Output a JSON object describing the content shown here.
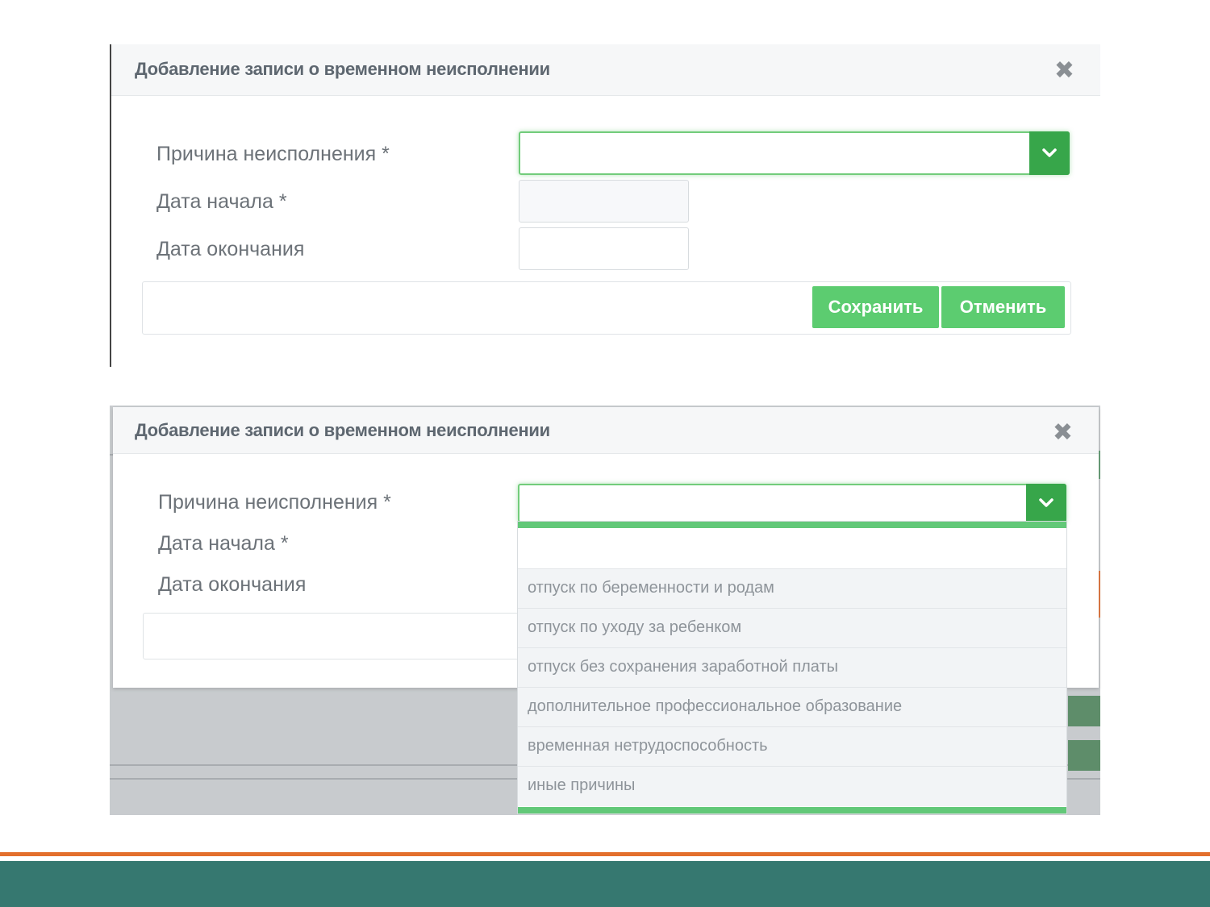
{
  "dialog_top": {
    "title": "Добавление записи о временном неисполнении",
    "close_glyph": "✖",
    "fields": {
      "reason_label": "Причина неисполнения  *",
      "reason_value": "",
      "start_label": "Дата начала  *",
      "start_value": "",
      "end_label": "Дата окончания",
      "end_value": ""
    },
    "buttons": {
      "save": "Сохранить",
      "cancel": "Отменить"
    }
  },
  "dialog_bottom": {
    "title": "Добавление записи о временном неисполнении",
    "close_glyph": "✖",
    "fields": {
      "reason_label": "Причина неисполнения  *",
      "start_label": "Дата начала  *",
      "end_label": "Дата окончания"
    },
    "dropdown": {
      "search_value": "",
      "options": [
        "отпуск по беременности и родам",
        "отпуск по уходу за ребенком",
        "отпуск без сохранения заработной платы",
        "дополнительное профессиональное образование",
        "временная нетрудоспособность",
        "иные причины"
      ]
    }
  },
  "icons": {
    "close": "close-icon",
    "dropdown": "chevron-down-icon"
  },
  "colors": {
    "accent_green": "#37a64a",
    "button_green": "#5ccc70",
    "slide_band": "#367870",
    "slide_accent": "#e36f2c"
  }
}
